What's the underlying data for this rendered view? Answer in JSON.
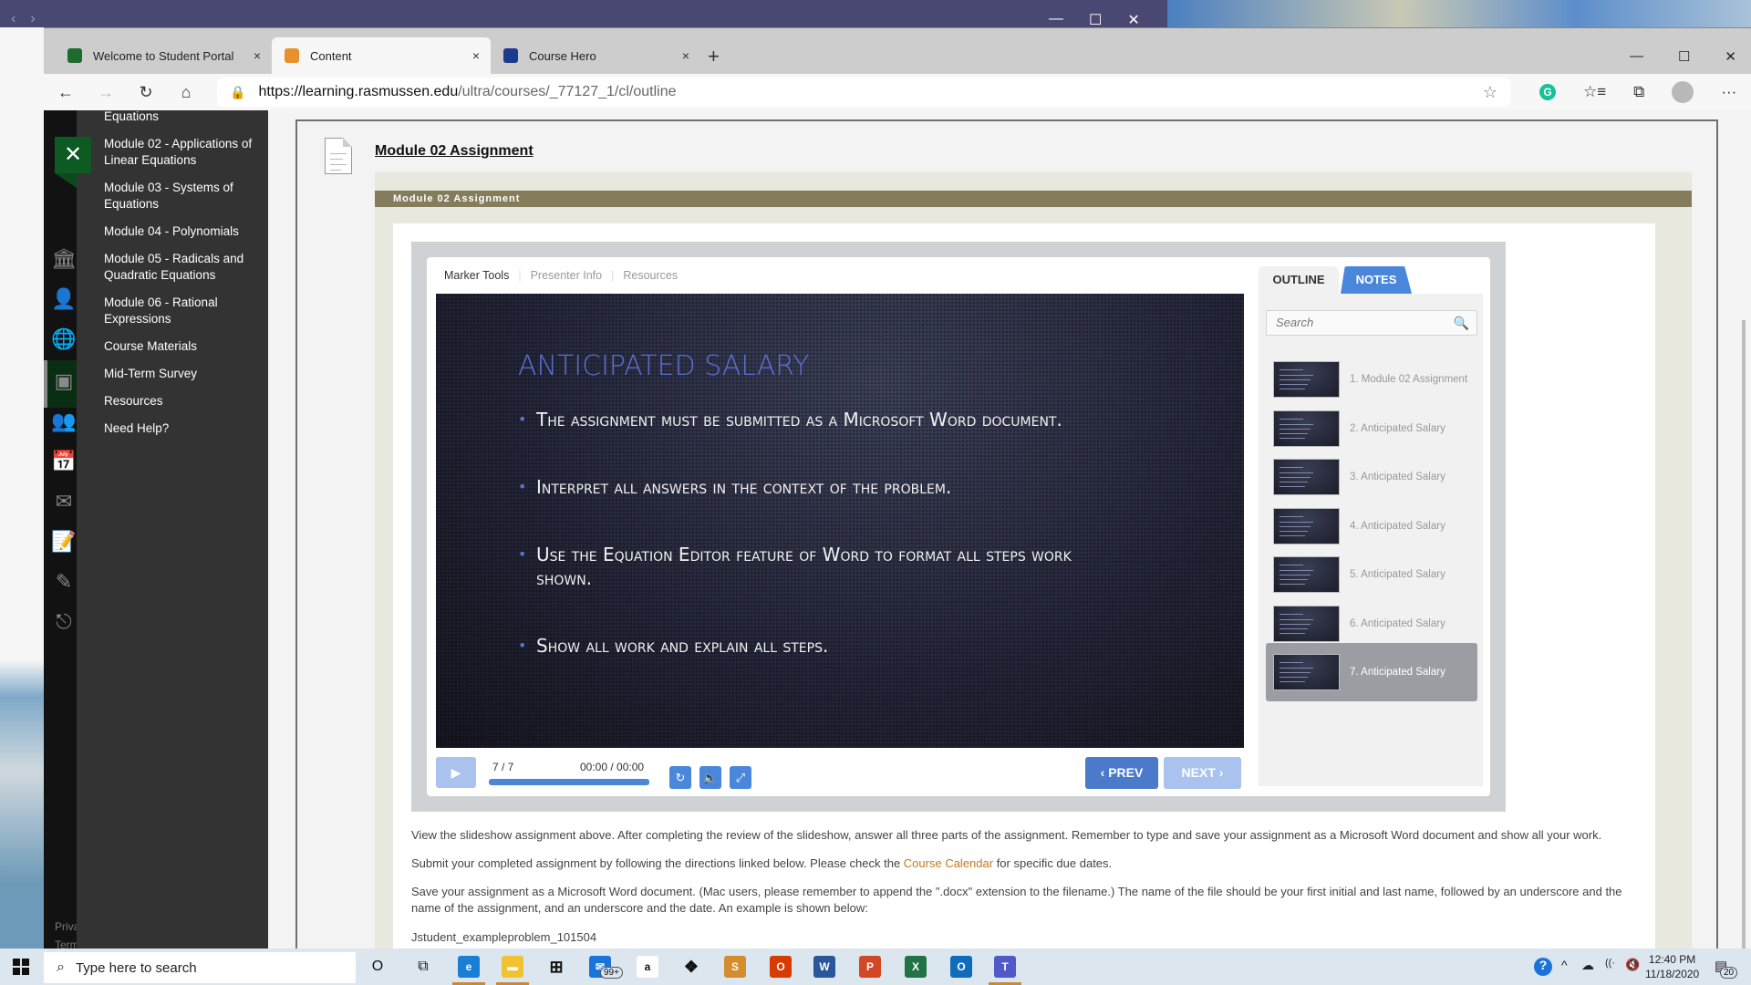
{
  "desktop": {
    "title_nav": [
      "‹",
      "›"
    ],
    "window_controls": [
      "—",
      "☐",
      "✕"
    ]
  },
  "browser": {
    "tabs": [
      {
        "label": "Welcome to Student Portal",
        "icon": "rasmussen-shield-icon",
        "color": "#1e6b2e",
        "active": false
      },
      {
        "label": "Content",
        "icon": "pencil-icon",
        "color": "#e8912a",
        "active": true
      },
      {
        "label": "Course Hero",
        "icon": "course-hero-icon",
        "color": "#1b3a8c",
        "active": false
      }
    ],
    "tab_close": "×",
    "new_tab": "+",
    "window_controls": [
      "—",
      "☐",
      "✕"
    ],
    "nav": {
      "back": "←",
      "forward": "→",
      "refresh": "↻",
      "home": "⌂"
    },
    "url_host": "https://learning.rasmussen.edu",
    "url_path": "/ultra/courses/_77127_1/cl/outline",
    "favorite_star": "☆",
    "toolbar_icons": {
      "grammarly": "G",
      "favorites": "☆≡",
      "collections": "⧉",
      "menu": "···"
    }
  },
  "lms": {
    "rail_close": "✕",
    "rail_icons": [
      "institution-icon",
      "profile-icon",
      "globe-icon",
      "courses-icon",
      "groups-icon",
      "calendar-icon",
      "messages-icon",
      "grades-icon",
      "tools-icon",
      "signout-icon"
    ],
    "rail_glyphs": [
      "🏛",
      "👤",
      "🌐",
      "▣",
      "👥",
      "📅",
      "✉",
      "📝",
      "✎",
      "⎋"
    ],
    "rail_footer": [
      "Priva",
      "Term"
    ],
    "flyout_items": [
      "Equations",
      "Module 02 - Applications of Linear Equations",
      "Module 03 - Systems of Equations",
      "Module 04 - Polynomials",
      "Module 05 - Radicals and Quadratic Equations",
      "Module 06 - Rational Expressions",
      "Course Materials",
      "Mid-Term Survey",
      "Resources",
      "Need Help?"
    ],
    "item_title": "Module 02 Assignment",
    "assignment_bar": "Module 02 Assignment"
  },
  "player": {
    "tabs": [
      "Marker Tools",
      "Presenter Info",
      "Resources"
    ],
    "slide": {
      "title": "Anticipated Salary",
      "bullets": [
        "The assignment must be submitted as a Microsoft Word document.",
        "Interpret all answers in the context of the problem.",
        "Use the Equation Editor feature of Word to format all steps work shown.",
        "Show all work and explain all steps."
      ]
    },
    "play": "▶",
    "slide_count": "7 / 7",
    "timecode": "00:00 / 00:00",
    "progress": 1.0,
    "control_glyphs": {
      "replay": "↻",
      "volume": "🔈",
      "fullscreen": "⤢"
    },
    "prev": "‹ PREV",
    "next": "NEXT ›",
    "outline_tab": "OUTLINE",
    "notes_tab": "NOTES",
    "search_placeholder": "Search",
    "search_icon": "🔍",
    "outline": [
      {
        "label": "1. Module 02 Assignment",
        "active": false
      },
      {
        "label": "2. Anticipated Salary",
        "active": false
      },
      {
        "label": "3. Anticipated Salary",
        "active": false
      },
      {
        "label": "4. Anticipated Salary",
        "active": false
      },
      {
        "label": "5. Anticipated Salary",
        "active": false
      },
      {
        "label": "6. Anticipated Salary",
        "active": false
      },
      {
        "label": "7. Anticipated Salary",
        "active": true
      }
    ]
  },
  "description": {
    "p1": "View the slideshow assignment above. After completing the review of the slideshow, answer all three parts of the assignment. Remember to type and save your assignment as a Microsoft Word document and show all your work.",
    "p2_before": "Submit your completed assignment by following the directions linked below. Please check the ",
    "p2_link": "Course Calendar",
    "p2_after": " for specific due dates.",
    "p3": "Save your assignment as a Microsoft Word document. (Mac users, please remember to append the \".docx\" extension to the filename.) The name of the file should be your first initial and last name, followed by an underscore and the name of the assignment, and an underscore and the date. An example is shown below:",
    "p4": "Jstudent_exampleproblem_101504"
  },
  "taskbar": {
    "search_placeholder": "Type here to search",
    "search_glyph": "⌕",
    "cortana": "O",
    "taskview": "⧉",
    "apps": [
      {
        "name": "edge",
        "glyph": "e",
        "color": "#1a7fd4"
      },
      {
        "name": "file-explorer",
        "glyph": "▬",
        "color": "#f1c232"
      },
      {
        "name": "store",
        "glyph": "⊞",
        "color": "#222"
      },
      {
        "name": "mail",
        "glyph": "✉",
        "color": "#1a73d9"
      },
      {
        "name": "amazon",
        "glyph": "a",
        "color": "#ffffff"
      },
      {
        "name": "dropbox",
        "glyph": "❖",
        "color": "#111"
      },
      {
        "name": "sublime",
        "glyph": "S",
        "color": "#d38d2d"
      },
      {
        "name": "office",
        "glyph": "O",
        "color": "#d83b01"
      },
      {
        "name": "word",
        "glyph": "W",
        "color": "#2b579a"
      },
      {
        "name": "powerpoint",
        "glyph": "P",
        "color": "#d24726"
      },
      {
        "name": "excel",
        "glyph": "X",
        "color": "#217346"
      },
      {
        "name": "outlook",
        "glyph": "O",
        "color": "#0f6cbd"
      },
      {
        "name": "teams",
        "glyph": "T",
        "color": "#5059c9"
      }
    ],
    "mail_badge": "99+",
    "tray": {
      "help": "?",
      "chevron": "^",
      "cloud": "☁",
      "wifi": "((·",
      "volume": "🔇"
    },
    "time": "12:40 PM",
    "date": "11/18/2020",
    "notifications": "20"
  }
}
